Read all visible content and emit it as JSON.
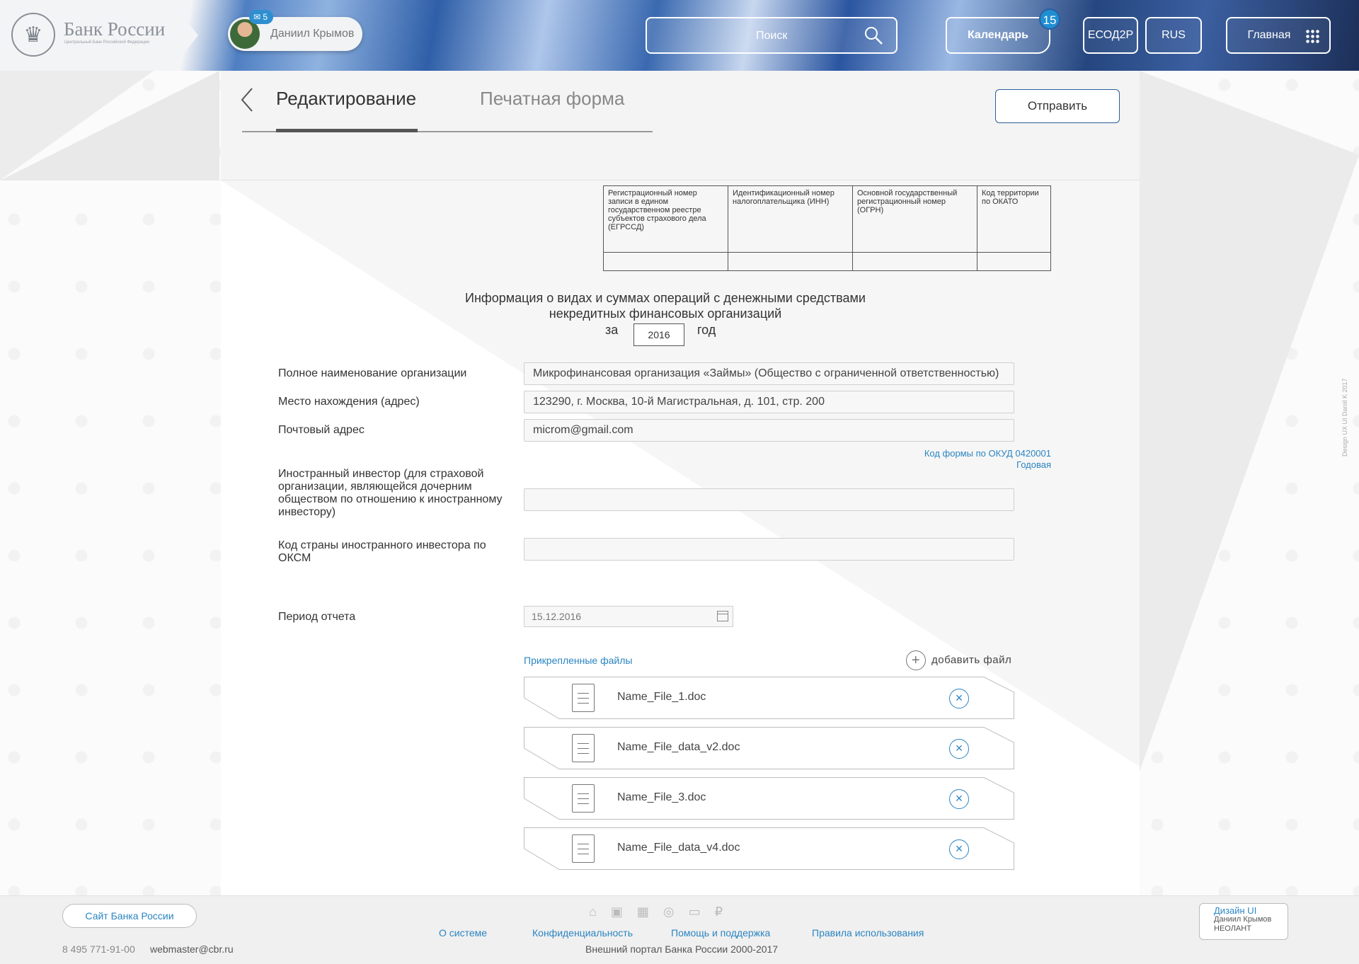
{
  "header": {
    "logo_title": "Банк России",
    "logo_subtitle": "Центральный Банк Российской Федерации",
    "user_name": "Даниил Крымов",
    "message_count": "5",
    "search_placeholder": "Поиск",
    "calendar_label": "Календарь",
    "calendar_count": "15",
    "esod_label": "ЕСОД2Р",
    "lang_label": "RUS",
    "main_label": "Главная"
  },
  "tabs": {
    "edit": "Редактирование",
    "print": "Печатная форма"
  },
  "send_label": "Отправить",
  "reg_table": {
    "headers": [
      "Регистрационный номер записи в едином государственном реестре субъектов страхового дела (ЕГРССД)",
      "Идентификационный номер налогоплательщика (ИНН)",
      "Основной государственный регистрационный номер (ОГРН)",
      "Код территории по ОКАТО"
    ]
  },
  "form": {
    "title_line1": "Информация о видах и суммах операций с денежными средствами",
    "title_line2": "некредитных финансовых организаций",
    "year_prefix": "за",
    "year": "2016",
    "year_suffix": "год",
    "fields": {
      "org_name_label": "Полное наименование организации",
      "org_name_value": "Микрофинансовая организация «Займы» (Общество с ограниченной ответственностью)",
      "address_label": "Место нахождения (адрес)",
      "address_value": "123290, г. Москва, 10-й Магистральная, д. 101, стр. 200",
      "postal_label": "Почтовый адрес",
      "postal_value": "microm@gmail.com",
      "okud_line1": "Код формы по ОКУД 0420001",
      "okud_line2": "Годовая",
      "foreign_investor_label": "Иностранный инвестор (для страховой организации, являющейся дочерним обществом по отношению к иностранному инвестору)",
      "foreign_investor_value": "",
      "country_code_label": "Код страны иностранного инвестора по ОКСМ",
      "country_code_value": "",
      "period_label": "Период отчета",
      "period_value": "15.12.2016"
    }
  },
  "files": {
    "label": "Прикрепленные файлы",
    "add_label": "добавить файл",
    "items": [
      "Name_File_1.doc",
      "Name_File_data_v2.doc",
      "Name_File_3.doc",
      "Name_File_data_v4.doc"
    ]
  },
  "credit": "Design UX UI Daniil K 2017",
  "footer": {
    "site_button": "Сайт Банка России",
    "phone": "8 495 771-91-00",
    "email": "webmaster@cbr.ru",
    "links": [
      "О системе",
      "Конфиденциальность",
      "Помощь и поддержка",
      "Правила использования"
    ],
    "copyright": "Внешний портал Банка России 2000-2017",
    "design_title": "Дизайн UI",
    "design_author": "Даниил Крымов",
    "design_company": "НЕОЛАНТ"
  },
  "colors": {
    "accent": "#2b85c2",
    "badge": "#1f8fd2",
    "send_border": "#2b5d9b"
  }
}
